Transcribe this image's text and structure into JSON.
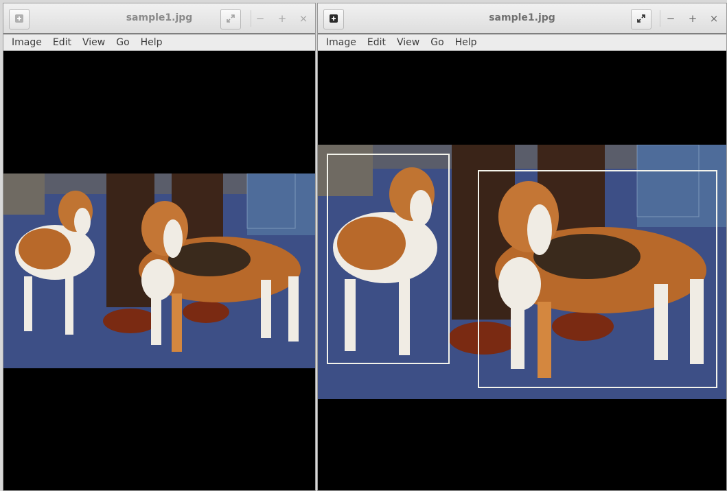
{
  "windows": [
    {
      "title": "sample1.jpg",
      "menu": [
        "Image",
        "Edit",
        "View",
        "Go",
        "Help"
      ],
      "controls": {
        "minimize": "−",
        "maximize": "+",
        "close": "×"
      },
      "image": {
        "alt": "two beagles",
        "annotated": false
      }
    },
    {
      "title": "sample1.jpg",
      "menu": [
        "Image",
        "Edit",
        "View",
        "Go",
        "Help"
      ],
      "controls": {
        "minimize": "−",
        "maximize": "+",
        "close": "×"
      },
      "image": {
        "alt": "two beagles",
        "annotated": true,
        "detections": 2
      }
    }
  ],
  "colors": {
    "background": "#000000",
    "bbox_stroke": "#f4f4ec",
    "floor": "#3d4f86",
    "dog_tan": "#b8692a",
    "dog_white": "#f0ece4"
  },
  "icons": [
    "menu-icon",
    "fullscreen-icon",
    "minimize-icon",
    "maximize-icon",
    "close-icon"
  ]
}
